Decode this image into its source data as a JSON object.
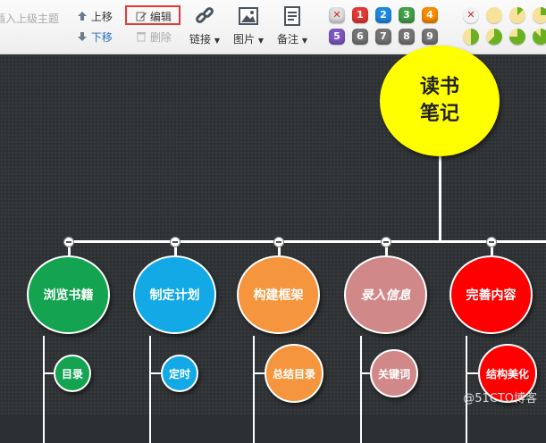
{
  "toolbar": {
    "insert_parent": "插入上级主题",
    "move_up": "上移",
    "move_down": "下移",
    "edit": "编辑",
    "delete": "删除",
    "link": "链接",
    "image": "图片",
    "note": "备注",
    "priorities": [
      {
        "label": "✕",
        "color": "#e0e0e0",
        "text_color": "#c62828"
      },
      {
        "label": "1",
        "color": "#e53935"
      },
      {
        "label": "2",
        "color": "#1e88e5"
      },
      {
        "label": "3",
        "color": "#43a047"
      },
      {
        "label": "4",
        "color": "#fb8c00"
      },
      {
        "label": "5",
        "color": "#7e57c2"
      },
      {
        "label": "6",
        "color": "#757575"
      },
      {
        "label": "7",
        "color": "#757575"
      },
      {
        "label": "8",
        "color": "#757575"
      },
      {
        "label": "9",
        "color": "#757575"
      }
    ],
    "progress_levels": [
      0,
      0,
      0.125,
      0.25,
      0.375,
      0.5,
      0.625,
      0.75,
      0.875,
      1
    ]
  },
  "mindmap": {
    "root": {
      "label_line1": "读书",
      "label_line2": "笔记",
      "color": "#ffff00"
    },
    "branches": [
      {
        "label": "浏览书籍",
        "color": "#13a351"
      },
      {
        "label": "制定计划",
        "color": "#12a9e6"
      },
      {
        "label": "构建框架",
        "color": "#f5963f"
      },
      {
        "label": "录入信息",
        "color": "#d08888"
      },
      {
        "label": "完善内容",
        "color": "#ff0000"
      }
    ],
    "children": [
      {
        "label": "目录",
        "color": "#13a351"
      },
      {
        "label": "定时",
        "color": "#12a9e6"
      },
      {
        "label": "总结目录",
        "color": "#f5963f"
      },
      {
        "label": "关键词",
        "color": "#d08888"
      },
      {
        "label": "结构美化",
        "color": "#ff0000"
      }
    ]
  },
  "watermark": "@51CTO博客"
}
